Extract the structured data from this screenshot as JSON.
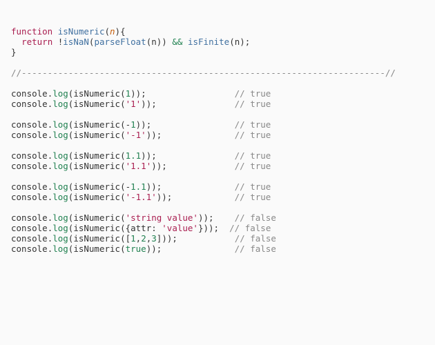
{
  "line1": {
    "kw": "function",
    "fn": "isNumeric",
    "arg": "n"
  },
  "line2": {
    "kw": "return",
    "neg": "!",
    "isnan": "isNaN",
    "pf": "parseFloat",
    "n1": "n",
    "op": "&&",
    "isf": "isFinite",
    "n2": "n"
  },
  "divider": "//----------------------------------------------------------------------//",
  "calls": [
    {
      "argtokens": [
        {
          "t": "num",
          "v": "1"
        }
      ],
      "close": "));",
      "pad": "                 ",
      "cmt": "// true"
    },
    {
      "argtokens": [
        {
          "t": "str",
          "v": "'1'"
        }
      ],
      "close": "));",
      "pad": "               ",
      "cmt": "// true"
    },
    null,
    {
      "argtokens": [
        {
          "t": "punct",
          "v": "-"
        },
        {
          "t": "num",
          "v": "1"
        }
      ],
      "close": "));",
      "pad": "                ",
      "cmt": "// true"
    },
    {
      "argtokens": [
        {
          "t": "str",
          "v": "'-1'"
        }
      ],
      "close": "));",
      "pad": "              ",
      "cmt": "// true"
    },
    null,
    {
      "argtokens": [
        {
          "t": "num",
          "v": "1.1"
        }
      ],
      "close": "));",
      "pad": "               ",
      "cmt": "// true"
    },
    {
      "argtokens": [
        {
          "t": "str",
          "v": "'1.1'"
        }
      ],
      "close": "));",
      "pad": "             ",
      "cmt": "// true"
    },
    null,
    {
      "argtokens": [
        {
          "t": "punct",
          "v": "-"
        },
        {
          "t": "num",
          "v": "1.1"
        }
      ],
      "close": "));",
      "pad": "              ",
      "cmt": "// true"
    },
    {
      "argtokens": [
        {
          "t": "str",
          "v": "'-1.1'"
        }
      ],
      "close": "));",
      "pad": "            ",
      "cmt": "// true"
    },
    null,
    {
      "argtokens": [
        {
          "t": "str",
          "v": "'string value'"
        }
      ],
      "close": "));",
      "pad": "    ",
      "cmt": "// false"
    },
    {
      "argtokens": [
        {
          "t": "punct",
          "v": "{attr: "
        },
        {
          "t": "str",
          "v": "'value'"
        },
        {
          "t": "punct",
          "v": "}"
        }
      ],
      "close": "));",
      "pad": "  ",
      "cmt": "// false"
    },
    {
      "argtokens": [
        {
          "t": "punct",
          "v": "["
        },
        {
          "t": "num",
          "v": "1"
        },
        {
          "t": "punct",
          "v": ","
        },
        {
          "t": "num",
          "v": "2"
        },
        {
          "t": "punct",
          "v": ","
        },
        {
          "t": "num",
          "v": "3"
        },
        {
          "t": "punct",
          "v": "]"
        }
      ],
      "close": "));",
      "pad": "           ",
      "cmt": "// false"
    },
    {
      "argtokens": [
        {
          "t": "bool",
          "v": "true"
        }
      ],
      "close": "));",
      "pad": "              ",
      "cmt": "// false"
    }
  ],
  "console": "console",
  "log": "log",
  "isnumcall": "isNumeric"
}
